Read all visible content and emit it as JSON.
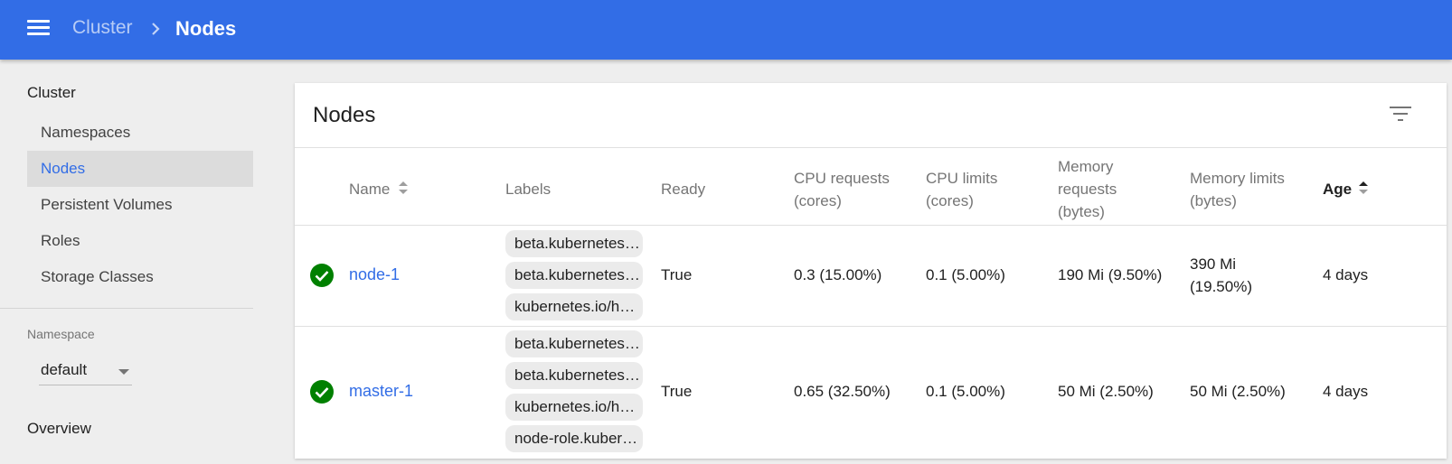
{
  "header": {
    "breadcrumb_parent": "Cluster",
    "breadcrumb_current": "Nodes"
  },
  "sidebar": {
    "section_title": "Cluster",
    "items": [
      {
        "label": "Namespaces",
        "active": false
      },
      {
        "label": "Nodes",
        "active": true
      },
      {
        "label": "Persistent Volumes",
        "active": false
      },
      {
        "label": "Roles",
        "active": false
      },
      {
        "label": "Storage Classes",
        "active": false
      }
    ],
    "namespace_label": "Namespace",
    "namespace_value": "default",
    "overview_label": "Overview"
  },
  "card": {
    "title": "Nodes",
    "columns": {
      "name": "Name",
      "labels": "Labels",
      "ready": "Ready",
      "cpu_requests": "CPU requests (cores)",
      "cpu_limits": "CPU limits (cores)",
      "memory_requests": "Memory requests (bytes)",
      "memory_limits": "Memory limits (bytes)",
      "age": "Age"
    },
    "rows": [
      {
        "name": "node-1",
        "labels": [
          "beta.kubernetes.i…",
          "beta.kubernetes.i…",
          "kubernetes.io/ho…"
        ],
        "ready": "True",
        "cpu_requests": "0.3 (15.00%)",
        "cpu_limits": "0.1 (5.00%)",
        "memory_requests": "190 Mi (9.50%)",
        "memory_limits": "390 Mi (19.50%)",
        "age": "4 days"
      },
      {
        "name": "master-1",
        "labels": [
          "beta.kubernetes.i…",
          "beta.kubernetes.i…",
          "kubernetes.io/ho…",
          "node-role.kubern…"
        ],
        "ready": "True",
        "cpu_requests": "0.65 (32.50%)",
        "cpu_limits": "0.1 (5.00%)",
        "memory_requests": "50 Mi (2.50%)",
        "memory_limits": "50 Mi (2.50%)",
        "age": "4 days"
      }
    ]
  },
  "colors": {
    "brand": "#326de6",
    "success": "#008000",
    "link": "#326de6"
  }
}
